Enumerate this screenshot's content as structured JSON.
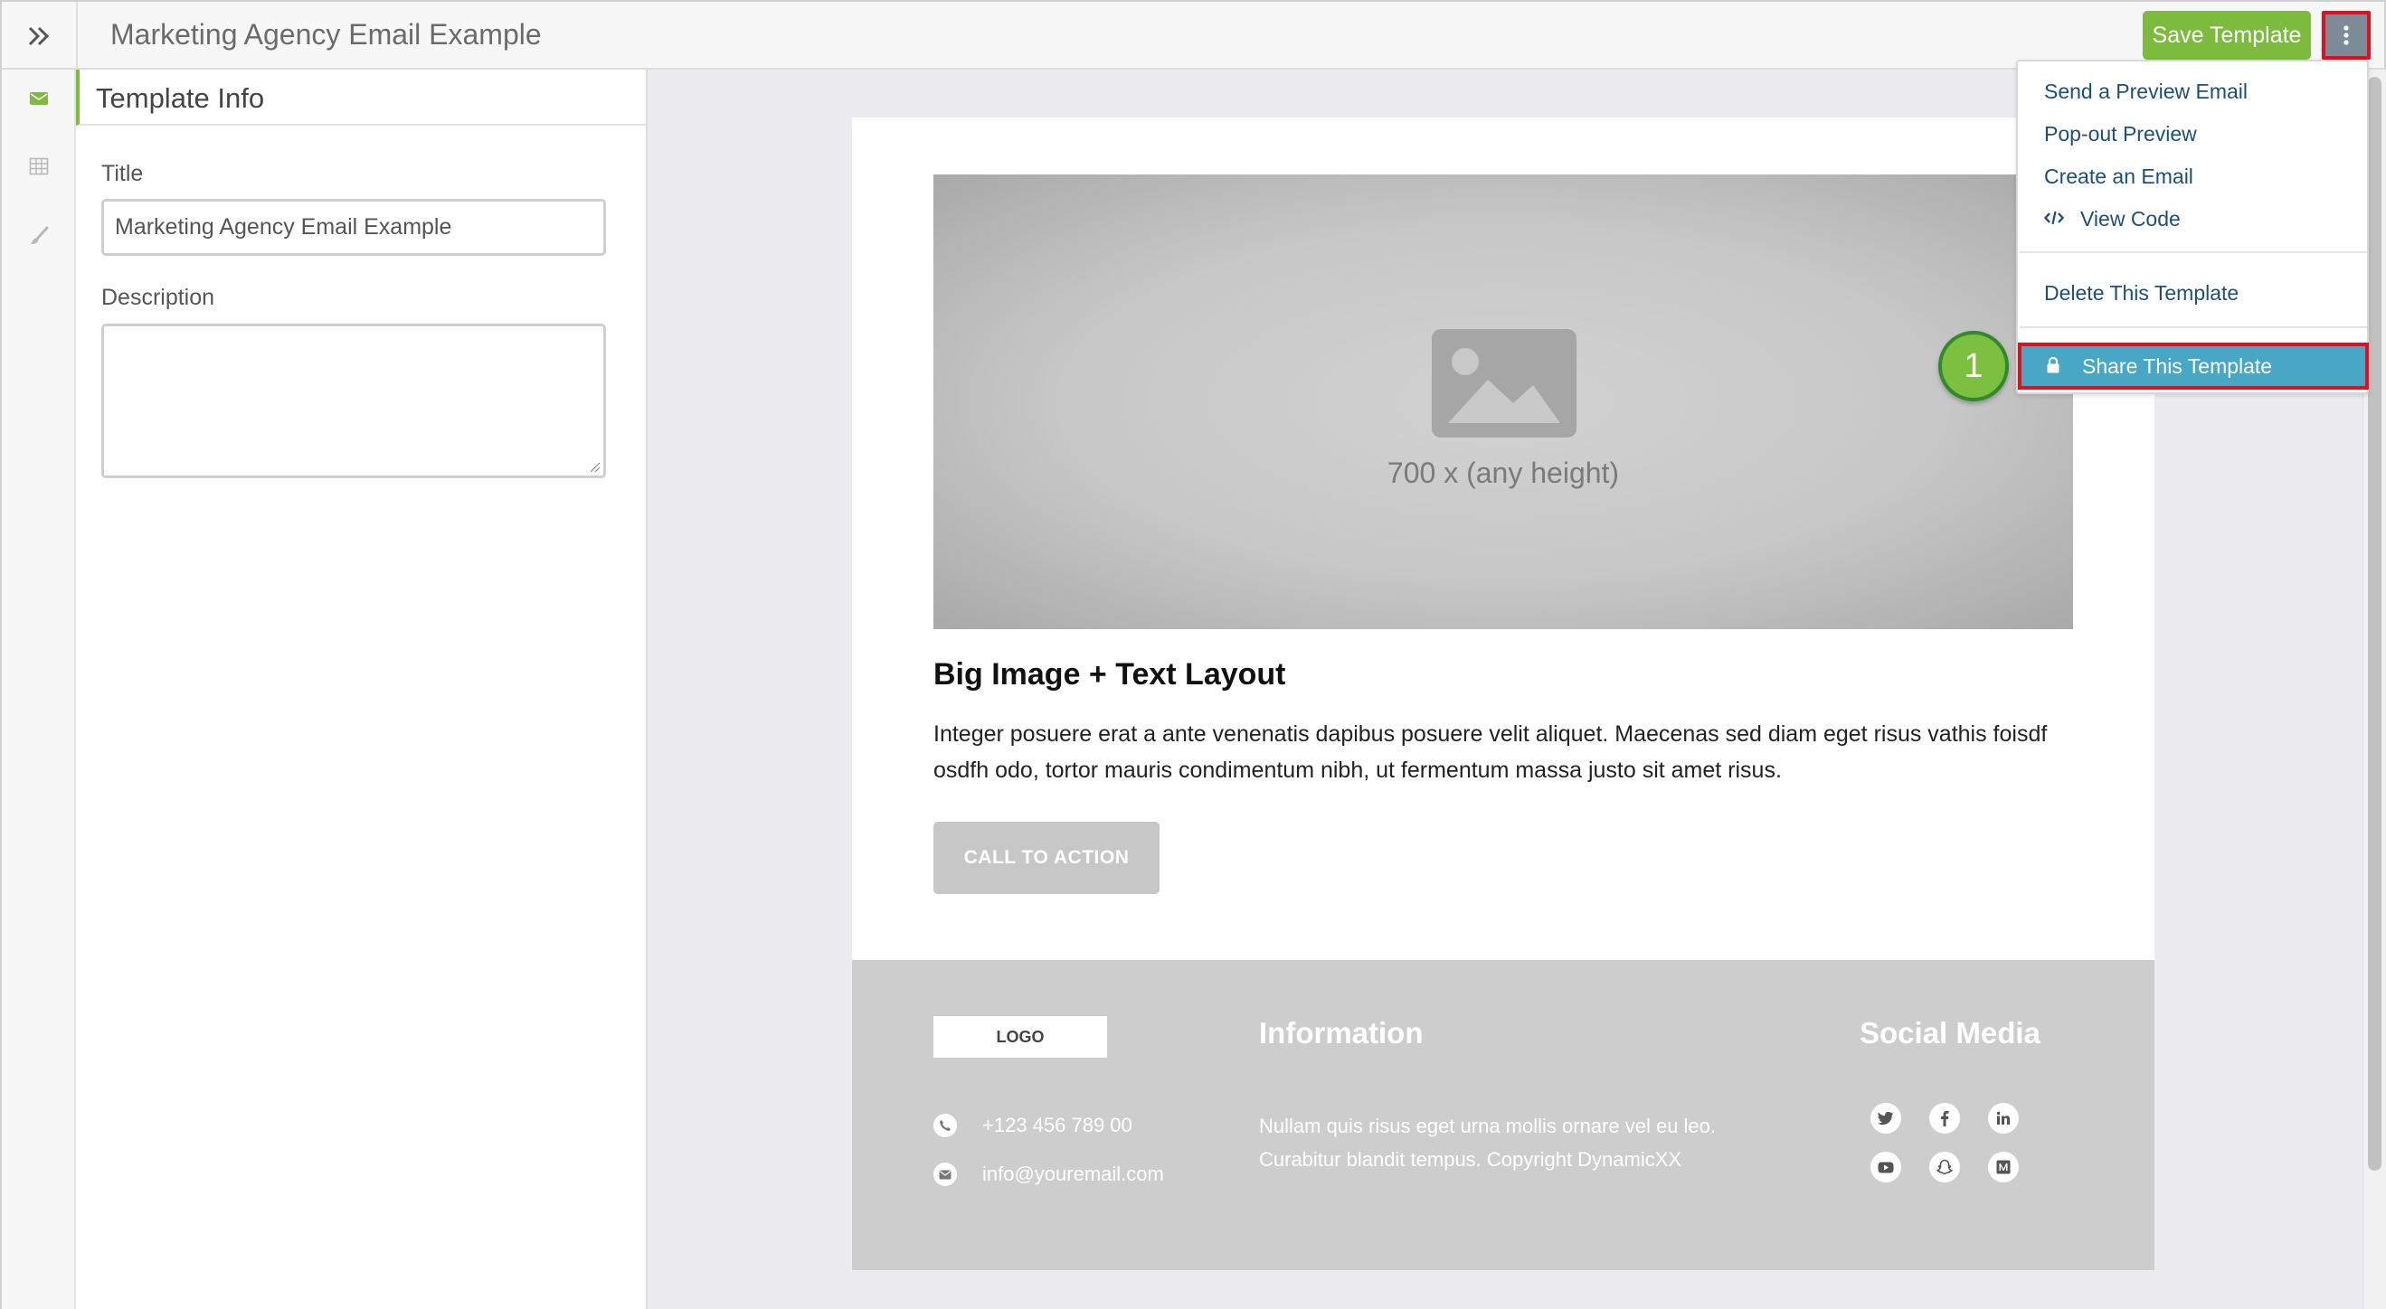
{
  "header": {
    "title": "Marketing Agency Email Example",
    "save_label": "Save Template",
    "expand_icon": "chevron-double-right-icon",
    "more_icon": "vertical-ellipsis-icon"
  },
  "rail": {
    "items": [
      {
        "icon": "envelope-icon",
        "active": true
      },
      {
        "icon": "table-grid-icon",
        "active": false
      },
      {
        "icon": "paintbrush-icon",
        "active": false
      }
    ]
  },
  "panel": {
    "header": "Template Info",
    "title_label": "Title",
    "title_value": "Marketing Agency Email Example",
    "description_label": "Description",
    "description_value": ""
  },
  "email": {
    "image_caption": "700 x (any height)",
    "heading": "Big Image + Text Layout",
    "body": "Integer posuere erat a ante venenatis dapibus posuere velit aliquet. Maecenas sed diam eget risus vathis foisdf osdfh odo, tortor mauris condimentum nibh, ut fermentum massa justo sit amet risus.",
    "cta_label": "CALL TO ACTION",
    "footer": {
      "logo": "LOGO",
      "phone": "+123 456 789 00",
      "email": "info@youremail.com",
      "info_heading": "Information",
      "info_text": "Nullam quis risus eget urna mollis ornare vel eu leo. Curabitur blandit tempus. Copyright DynamicXX",
      "social_heading": "Social Media",
      "social_icons": [
        "twitter-icon",
        "facebook-icon",
        "linkedin-icon",
        "youtube-icon",
        "snapchat-icon",
        "medium-icon"
      ]
    }
  },
  "menu": {
    "items": [
      {
        "label": "Send a Preview Email"
      },
      {
        "label": "Pop-out Preview"
      },
      {
        "label": "Create an Email"
      },
      {
        "label": "View Code",
        "icon": "code-icon"
      },
      {
        "label": "Delete This Template"
      },
      {
        "label": "Share This Template",
        "icon": "lock-icon",
        "highlighted": true
      }
    ]
  },
  "annotation": {
    "step": "1"
  },
  "colors": {
    "accent_green": "#7dbb3f",
    "menu_highlight": "#47a7c5",
    "annotation_red": "#e0101e",
    "link_blue": "#1d4f79"
  }
}
